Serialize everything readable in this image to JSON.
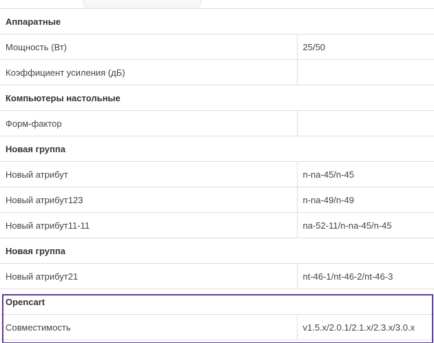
{
  "groups": [
    {
      "title": "Аппаратные",
      "rows": [
        {
          "name": "Мощность (Вт)",
          "value": "25/50"
        },
        {
          "name": "Коэффициент усиления (дБ)",
          "value": ""
        }
      ]
    },
    {
      "title": "Компьютеры настольные",
      "rows": [
        {
          "name": "Форм-фактор",
          "value": ""
        }
      ]
    },
    {
      "title": "Новая группа",
      "rows": [
        {
          "name": "Новый атрибут",
          "value": "n-na-45/n-45"
        },
        {
          "name": "Новый атрибут123",
          "value": "n-na-49/n-49"
        },
        {
          "name": "Новый атрибут11-11",
          "value": "na-52-11/n-na-45/n-45"
        }
      ]
    },
    {
      "title": "Новая группа",
      "rows": [
        {
          "name": "Новый атрибут21",
          "value": "nt-46-1/nt-46-2/nt-46-3"
        }
      ]
    },
    {
      "title": "Opencart",
      "rows": [
        {
          "name": "Совместимость",
          "value": "v1.5.x/2.0.1/2.1.x/2.3.x/3.0.x"
        }
      ]
    }
  ],
  "colors": {
    "border": "#dddddd",
    "text": "#444444",
    "highlight_border": "#5b3b8c"
  }
}
